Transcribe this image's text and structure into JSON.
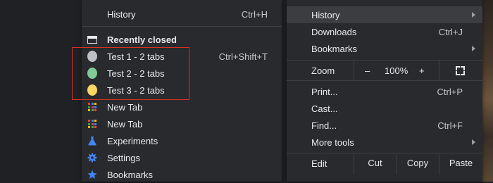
{
  "history_menu": {
    "history_label": "History",
    "history_shortcut": "Ctrl+H",
    "recently_closed_label": "Recently closed",
    "closed_groups": [
      {
        "label": "Test 1 - 2 tabs",
        "shortcut": "Ctrl+Shift+T",
        "color": "#bdc1c6"
      },
      {
        "label": "Test 2 - 2 tabs",
        "shortcut": "",
        "color": "#81c995"
      },
      {
        "label": "Test 3 - 2 tabs",
        "shortcut": "",
        "color": "#fdd663"
      }
    ],
    "closed_items": [
      {
        "label": "New Tab",
        "icon": "new-tab-grid-icon"
      },
      {
        "label": "New Tab",
        "icon": "new-tab-grid-icon"
      },
      {
        "label": "Experiments",
        "icon": "flask-icon"
      },
      {
        "label": "Settings",
        "icon": "gear-icon"
      },
      {
        "label": "Bookmarks",
        "icon": "star-icon"
      }
    ],
    "highlight_color": "#d93025"
  },
  "main_menu": {
    "history_label": "History",
    "downloads_label": "Downloads",
    "downloads_shortcut": "Ctrl+J",
    "bookmarks_label": "Bookmarks",
    "zoom": {
      "label": "Zoom",
      "minus": "–",
      "level": "100%",
      "plus": "+"
    },
    "print_label": "Print...",
    "print_shortcut": "Ctrl+P",
    "cast_label": "Cast...",
    "find_label": "Find...",
    "find_shortcut": "Ctrl+F",
    "more_tools_label": "More tools",
    "edit": {
      "label": "Edit",
      "cut": "Cut",
      "copy": "Copy",
      "paste": "Paste"
    }
  },
  "colors": {
    "menu_bg": "#292a2d",
    "icon_blue": "#4285f4"
  }
}
